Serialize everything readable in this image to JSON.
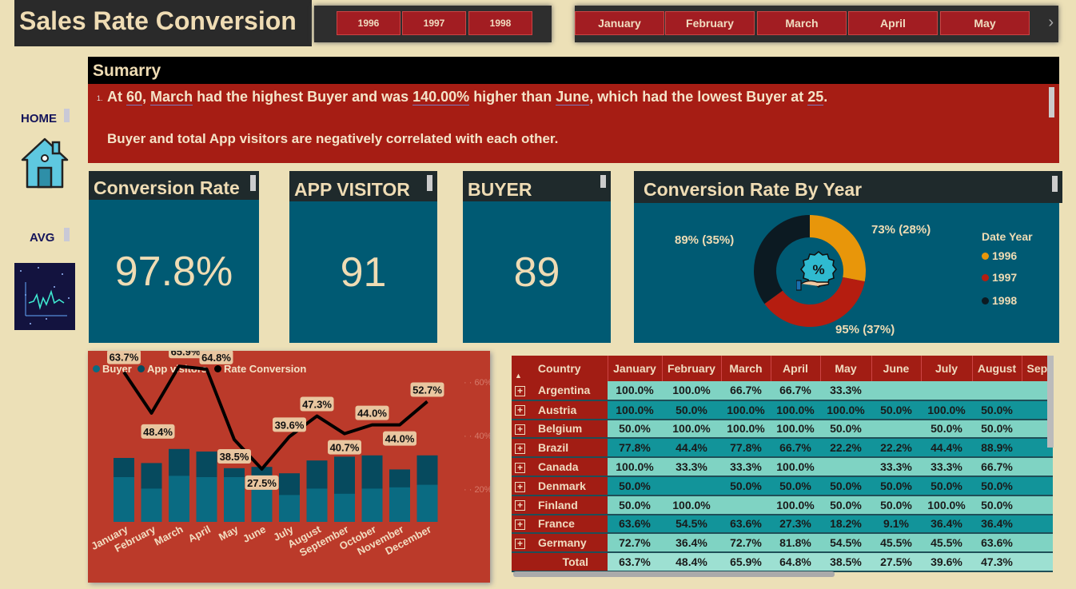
{
  "title": "Sales Rate Conversion",
  "years": [
    "1996",
    "1997",
    "1998"
  ],
  "months_slicer": [
    "January",
    "February",
    "March",
    "April",
    "May"
  ],
  "nav": {
    "home_label": "HOME",
    "avg_label": "AVG",
    "next_glyph": "›"
  },
  "summary": {
    "title": "Sumarry",
    "item_number": "1.",
    "line1": {
      "p1": "At ",
      "v1": "60",
      "p2": ", ",
      "v2": "March",
      "p3": " had the highest Buyer and was ",
      "v3": "140.00%",
      "p4": " higher than ",
      "v4": "June",
      "p5": ", which had the lowest Buyer at ",
      "v5": "25",
      "p6": "."
    },
    "line2": "Buyer and total App visitors are negatively correlated with each other."
  },
  "kpis": {
    "conversion": {
      "label": "Conversion Rate",
      "value": "97.8%"
    },
    "visitor": {
      "label": "APP VISITOR",
      "value": "91"
    },
    "buyer": {
      "label": "BUYER",
      "value": "89"
    }
  },
  "donut": {
    "title": "Conversion Rate By Year",
    "legend_title": "Date Year",
    "colors": {
      "1996": "#e8960a",
      "1997": "#b51d10",
      "1998": "#0c1a22"
    },
    "slices": [
      {
        "year": "1996",
        "label": "73% (28%)",
        "share": 28
      },
      {
        "year": "1997",
        "label": "95% (37%)",
        "share": 37
      },
      {
        "year": "1998",
        "label": "89% (35%)",
        "share": 35
      }
    ]
  },
  "combo_legend": {
    "buyer": "Buyer",
    "visitors": "App visitors",
    "rate": "Rate Conversion"
  },
  "chart_data": {
    "type": "bar",
    "categories": [
      "January",
      "February",
      "March",
      "April",
      "May",
      "June",
      "July",
      "August",
      "September",
      "October",
      "November",
      "December"
    ],
    "series": [
      {
        "name": "Buyer",
        "values": [
          35,
          26,
          36,
          35,
          35,
          25,
          21,
          26,
          22,
          26,
          27,
          29
        ]
      },
      {
        "name": "App visitors",
        "values": [
          50,
          46,
          57,
          55,
          42,
          43,
          38,
          48,
          51,
          52,
          41,
          52
        ]
      },
      {
        "name": "Rate Conversion",
        "values": [
          63.7,
          48.4,
          65.9,
          64.8,
          38.5,
          27.5,
          39.6,
          47.3,
          40.7,
          44.0,
          44.0,
          52.7
        ]
      }
    ],
    "rate_labels": [
      "63.7%",
      "48.4%",
      "65.9%",
      "64.8%",
      "38.5%",
      "27.5%",
      "39.6%",
      "47.3%",
      "40.7%",
      "44.0%",
      "44.0%",
      "52.7%"
    ],
    "y2_ticks": [
      "60%",
      "40%",
      "20%"
    ],
    "colors": {
      "Buyer": "#0a6b82",
      "App visitors": "#064a5e",
      "Rate Conversion": "#000000"
    }
  },
  "table": {
    "headers": [
      "Country",
      "January",
      "February",
      "March",
      "April",
      "May",
      "June",
      "July",
      "August",
      "Sep"
    ],
    "rows": [
      [
        "Argentina",
        "100.0%",
        "100.0%",
        "66.7%",
        "66.7%",
        "33.3%",
        "",
        "",
        ""
      ],
      [
        "Austria",
        "100.0%",
        "50.0%",
        "100.0%",
        "100.0%",
        "100.0%",
        "50.0%",
        "100.0%",
        "50.0%"
      ],
      [
        "Belgium",
        "50.0%",
        "100.0%",
        "100.0%",
        "100.0%",
        "50.0%",
        "",
        "50.0%",
        "50.0%"
      ],
      [
        "Brazil",
        "77.8%",
        "44.4%",
        "77.8%",
        "66.7%",
        "22.2%",
        "22.2%",
        "44.4%",
        "88.9%"
      ],
      [
        "Canada",
        "100.0%",
        "33.3%",
        "33.3%",
        "100.0%",
        "",
        "33.3%",
        "33.3%",
        "66.7%"
      ],
      [
        "Denmark",
        "50.0%",
        "",
        "50.0%",
        "50.0%",
        "50.0%",
        "50.0%",
        "50.0%",
        "50.0%"
      ],
      [
        "Finland",
        "50.0%",
        "100.0%",
        "",
        "100.0%",
        "50.0%",
        "50.0%",
        "100.0%",
        "50.0%"
      ],
      [
        "France",
        "63.6%",
        "54.5%",
        "63.6%",
        "27.3%",
        "18.2%",
        "9.1%",
        "36.4%",
        "36.4%"
      ],
      [
        "Germany",
        "72.7%",
        "36.4%",
        "72.7%",
        "81.8%",
        "54.5%",
        "45.5%",
        "45.5%",
        "63.6%"
      ]
    ],
    "total": [
      "Total",
      "63.7%",
      "48.4%",
      "65.9%",
      "64.8%",
      "38.5%",
      "27.5%",
      "39.6%",
      "47.3%"
    ]
  }
}
